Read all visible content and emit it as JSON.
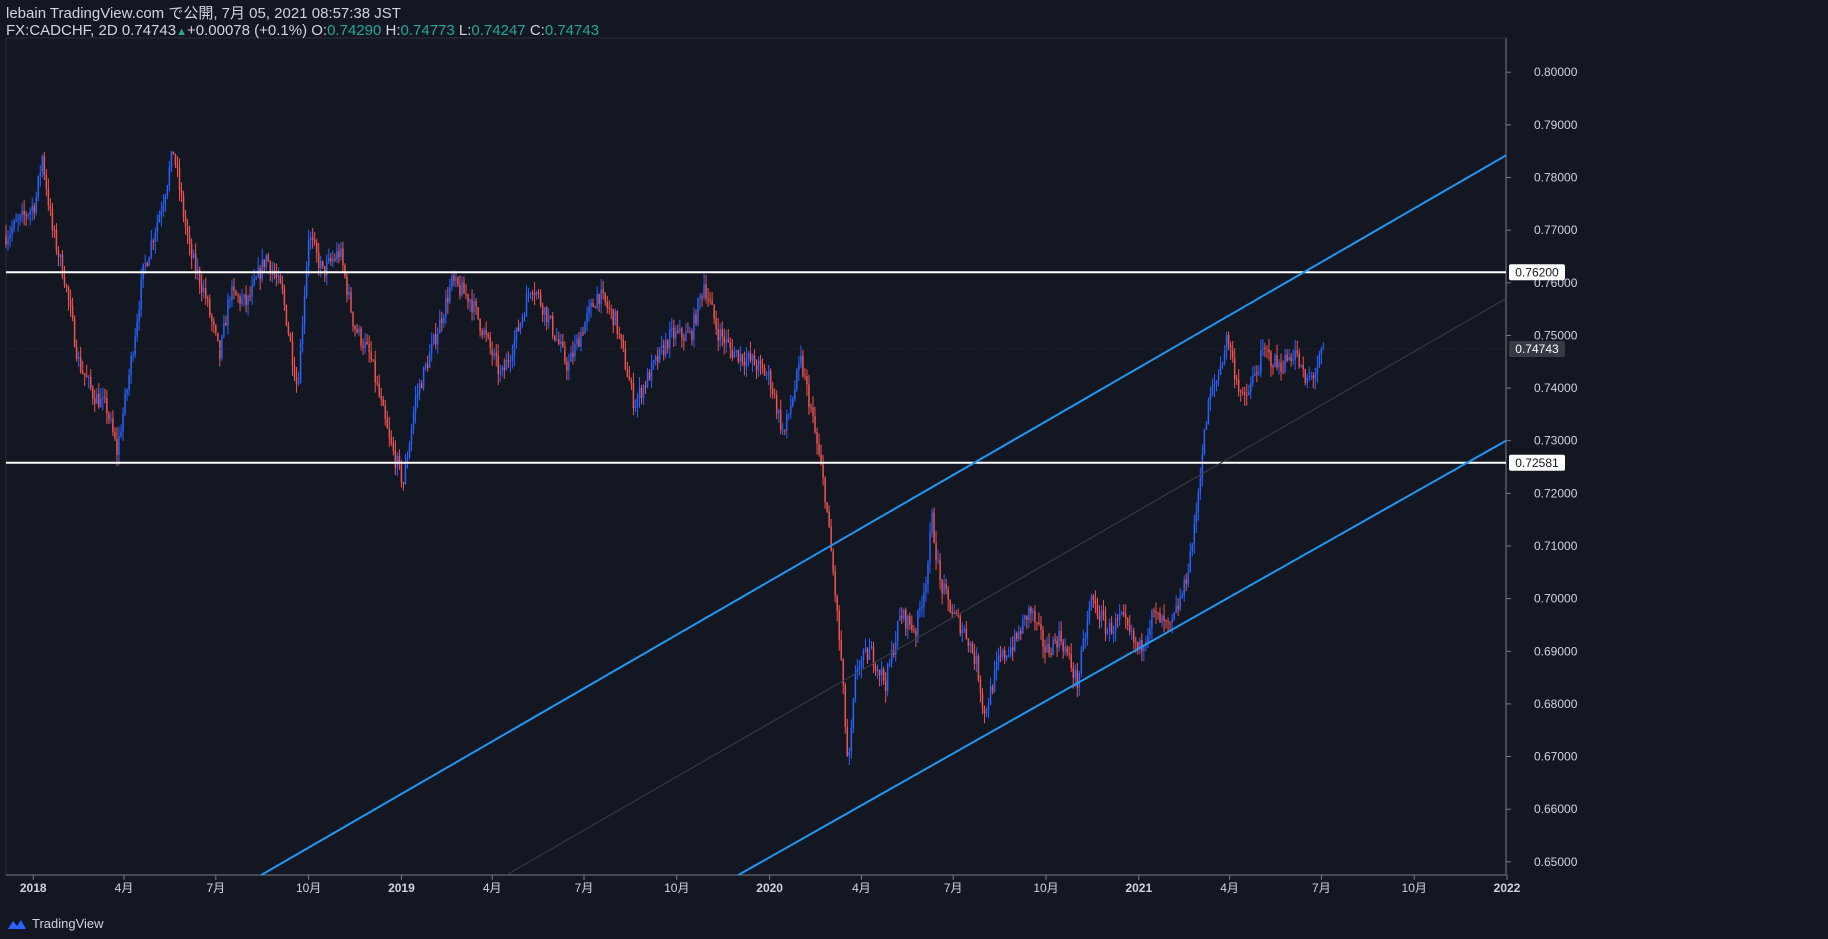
{
  "header": {
    "line1": "lebain TradingView.com で公開, 7月 05, 2021 08:57:38 JST",
    "symbol": "FX:CADCHF, 2D",
    "last": "0.74743",
    "change": "+0.00078 (+0.1%)",
    "o_label": "O:",
    "o_value": "0.74290",
    "h_label": "H:",
    "h_value": "0.74773",
    "l_label": "L:",
    "l_value": "0.74247",
    "c_label": "C:",
    "c_value": "0.74743"
  },
  "footer": {
    "brand": "TradingView",
    "logo_icon": "tradingview-logo-icon"
  },
  "colors": {
    "background": "#131722",
    "up": "#2962ff",
    "down": "#ef5350",
    "channel": "#2196f3",
    "level": "#ffffff",
    "text": "#d1d4dc",
    "value_text": "#26a69a"
  },
  "chart_data": {
    "type": "candlestick",
    "symbol": "FX:CADCHF",
    "interval": "2D",
    "x_range": [
      "2017-12-05",
      "2021-12-31"
    ],
    "y_range": [
      0.6475,
      0.8065
    ],
    "x_ticks": [
      {
        "date": "2018-01-01",
        "label": "2018"
      },
      {
        "date": "2018-04-01",
        "label": "4月"
      },
      {
        "date": "2018-07-01",
        "label": "7月"
      },
      {
        "date": "2018-10-01",
        "label": "10月"
      },
      {
        "date": "2019-01-01",
        "label": "2019"
      },
      {
        "date": "2019-04-01",
        "label": "4月"
      },
      {
        "date": "2019-07-01",
        "label": "7月"
      },
      {
        "date": "2019-10-01",
        "label": "10月"
      },
      {
        "date": "2020-01-01",
        "label": "2020"
      },
      {
        "date": "2020-04-01",
        "label": "4月"
      },
      {
        "date": "2020-07-01",
        "label": "7月"
      },
      {
        "date": "2020-10-01",
        "label": "10月"
      },
      {
        "date": "2021-01-01",
        "label": "2021"
      },
      {
        "date": "2021-04-01",
        "label": "4月"
      },
      {
        "date": "2021-07-01",
        "label": "7月"
      },
      {
        "date": "2021-10-01",
        "label": "10月"
      },
      {
        "date": "2022-01-01",
        "label": "2022"
      }
    ],
    "y_ticks": [
      "0.65000",
      "0.66000",
      "0.67000",
      "0.68000",
      "0.69000",
      "0.70000",
      "0.71000",
      "0.72000",
      "0.73000",
      "0.74000",
      "0.75000",
      "0.76000",
      "0.77000",
      "0.78000",
      "0.79000",
      "0.80000"
    ],
    "price_labels": [
      {
        "value": 0.762,
        "label": "0.76200",
        "style": "level"
      },
      {
        "value": 0.74743,
        "label": "0.74743",
        "style": "last"
      },
      {
        "value": 0.72581,
        "label": "0.72581",
        "style": "level"
      }
    ],
    "horizontal_levels": [
      0.762,
      0.72581
    ],
    "trend_lines": [
      {
        "name": "upper",
        "points": [
          [
            "2018-08-15",
            0.6475
          ],
          [
            "2021-12-31",
            0.7842
          ]
        ]
      },
      {
        "name": "lower",
        "points": [
          [
            "2019-12-01",
            0.6475
          ],
          [
            "2021-12-31",
            0.73
          ]
        ]
      },
      {
        "name": "median",
        "faint": true,
        "points": [
          [
            "2019-04-15",
            0.6475
          ],
          [
            "2021-12-31",
            0.757
          ]
        ]
      }
    ],
    "price_path": [
      [
        "2017-12-05",
        0.769
      ],
      [
        "2017-12-20",
        0.772
      ],
      [
        "2018-01-03",
        0.775
      ],
      [
        "2018-01-10",
        0.784
      ],
      [
        "2018-01-20",
        0.77
      ],
      [
        "2018-02-01",
        0.761
      ],
      [
        "2018-02-15",
        0.745
      ],
      [
        "2018-03-01",
        0.739
      ],
      [
        "2018-03-15",
        0.736
      ],
      [
        "2018-03-25",
        0.728
      ],
      [
        "2018-04-05",
        0.741
      ],
      [
        "2018-04-20",
        0.762
      ],
      [
        "2018-05-10",
        0.776
      ],
      [
        "2018-05-20",
        0.785
      ],
      [
        "2018-06-05",
        0.766
      ],
      [
        "2018-06-20",
        0.758
      ],
      [
        "2018-07-05",
        0.746
      ],
      [
        "2018-07-15",
        0.758
      ],
      [
        "2018-08-01",
        0.756
      ],
      [
        "2018-08-20",
        0.765
      ],
      [
        "2018-09-05",
        0.758
      ],
      [
        "2018-09-20",
        0.74
      ],
      [
        "2018-10-01",
        0.769
      ],
      [
        "2018-10-15",
        0.762
      ],
      [
        "2018-11-01",
        0.766
      ],
      [
        "2018-11-15",
        0.752
      ],
      [
        "2018-12-01",
        0.746
      ],
      [
        "2018-12-20",
        0.73
      ],
      [
        "2019-01-03",
        0.722
      ],
      [
        "2019-01-15",
        0.738
      ],
      [
        "2019-02-01",
        0.748
      ],
      [
        "2019-02-20",
        0.76
      ],
      [
        "2019-03-10",
        0.757
      ],
      [
        "2019-03-25",
        0.75
      ],
      [
        "2019-04-10",
        0.742
      ],
      [
        "2019-04-25",
        0.75
      ],
      [
        "2019-05-10",
        0.76
      ],
      [
        "2019-05-25",
        0.754
      ],
      [
        "2019-06-15",
        0.744
      ],
      [
        "2019-07-01",
        0.752
      ],
      [
        "2019-07-15",
        0.758
      ],
      [
        "2019-08-01",
        0.753
      ],
      [
        "2019-08-20",
        0.737
      ],
      [
        "2019-09-05",
        0.743
      ],
      [
        "2019-09-25",
        0.75
      ],
      [
        "2019-10-15",
        0.75
      ],
      [
        "2019-10-28",
        0.76
      ],
      [
        "2019-11-10",
        0.751
      ],
      [
        "2019-11-25",
        0.747
      ],
      [
        "2019-12-15",
        0.745
      ],
      [
        "2020-01-01",
        0.742
      ],
      [
        "2020-01-15",
        0.731
      ],
      [
        "2020-02-01",
        0.745
      ],
      [
        "2020-02-10",
        0.737
      ],
      [
        "2020-02-25",
        0.72
      ],
      [
        "2020-03-05",
        0.703
      ],
      [
        "2020-03-12",
        0.688
      ],
      [
        "2020-03-19",
        0.667
      ],
      [
        "2020-03-27",
        0.687
      ],
      [
        "2020-04-10",
        0.69
      ],
      [
        "2020-04-25",
        0.684
      ],
      [
        "2020-05-10",
        0.697
      ],
      [
        "2020-05-25",
        0.694
      ],
      [
        "2020-06-05",
        0.705
      ],
      [
        "2020-06-10",
        0.715
      ],
      [
        "2020-06-18",
        0.703
      ],
      [
        "2020-07-01",
        0.697
      ],
      [
        "2020-07-15",
        0.693
      ],
      [
        "2020-07-25",
        0.687
      ],
      [
        "2020-08-01",
        0.678
      ],
      [
        "2020-08-15",
        0.688
      ],
      [
        "2020-09-01",
        0.692
      ],
      [
        "2020-09-15",
        0.698
      ],
      [
        "2020-10-01",
        0.69
      ],
      [
        "2020-10-15",
        0.693
      ],
      [
        "2020-11-01",
        0.684
      ],
      [
        "2020-11-15",
        0.7
      ],
      [
        "2020-12-01",
        0.694
      ],
      [
        "2020-12-15",
        0.696
      ],
      [
        "2021-01-01",
        0.69
      ],
      [
        "2021-01-15",
        0.697
      ],
      [
        "2021-02-01",
        0.694
      ],
      [
        "2021-02-15",
        0.702
      ],
      [
        "2021-02-25",
        0.713
      ],
      [
        "2021-03-05",
        0.728
      ],
      [
        "2021-03-12",
        0.738
      ],
      [
        "2021-03-20",
        0.742
      ],
      [
        "2021-03-30",
        0.75
      ],
      [
        "2021-04-05",
        0.744
      ],
      [
        "2021-04-15",
        0.737
      ],
      [
        "2021-04-25",
        0.742
      ],
      [
        "2021-05-05",
        0.747
      ],
      [
        "2021-05-20",
        0.744
      ],
      [
        "2021-06-05",
        0.747
      ],
      [
        "2021-06-15",
        0.741
      ],
      [
        "2021-06-25",
        0.743
      ],
      [
        "2021-07-04",
        0.74743
      ]
    ]
  }
}
